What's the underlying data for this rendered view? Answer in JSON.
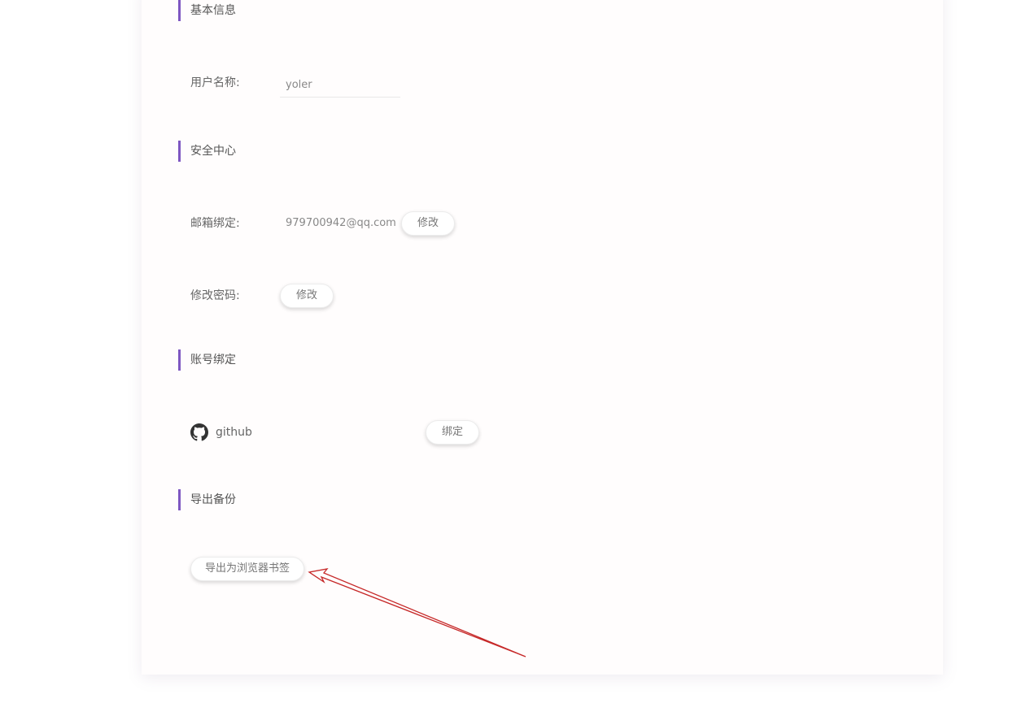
{
  "sections": {
    "basic_info": "基本信息",
    "security": "安全中心",
    "account_binding": "账号绑定",
    "export_backup": "导出备份"
  },
  "basic": {
    "username_label": "用户名称:",
    "username_value": "yoler"
  },
  "security": {
    "email_label": "邮箱绑定:",
    "email_value": "979700942@qq.com",
    "email_modify_button": "修改",
    "password_label": "修改密码:",
    "password_modify_button": "修改"
  },
  "binding": {
    "github_label": "github",
    "github_icon": "github-icon",
    "bind_button": "绑定"
  },
  "export": {
    "export_button": "导出为浏览器书签"
  },
  "colors": {
    "accent": "#7e57c2",
    "annotation_arrow": "#c62828"
  }
}
